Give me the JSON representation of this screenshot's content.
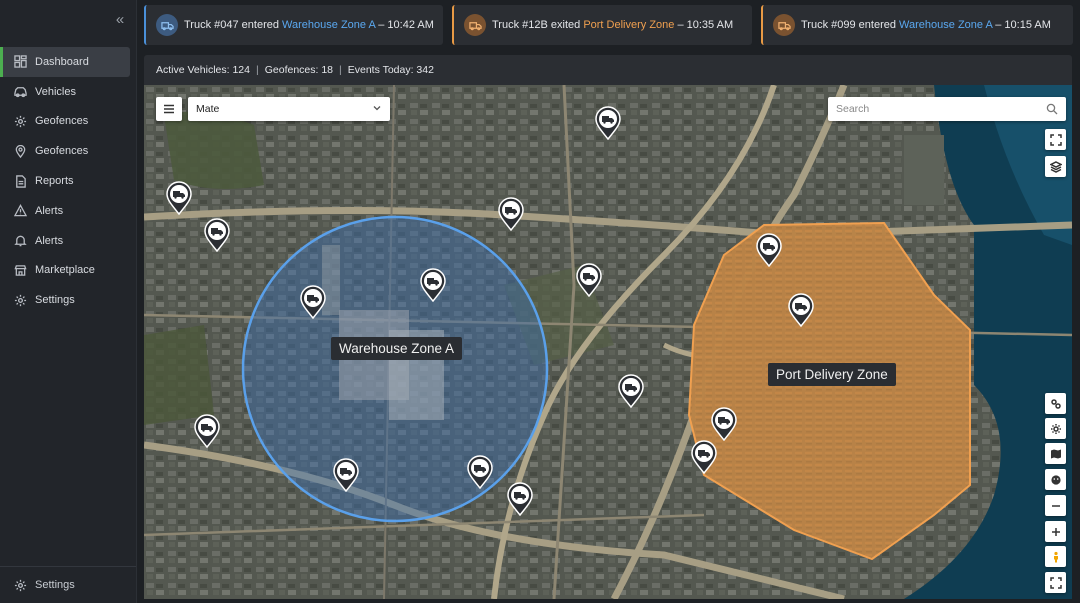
{
  "sidebar": {
    "items": [
      {
        "label": "Dashboard",
        "icon": "dashboard-icon",
        "active": true
      },
      {
        "label": "Vehicles",
        "icon": "car-icon"
      },
      {
        "label": "Geofences",
        "icon": "geofence-icon"
      },
      {
        "label": "Geofences",
        "icon": "location-pin-icon"
      },
      {
        "label": "Reports",
        "icon": "report-icon"
      },
      {
        "label": "Alerts",
        "icon": "warning-icon"
      },
      {
        "label": "Alerts",
        "icon": "bell-icon"
      },
      {
        "label": "Marketplace",
        "icon": "store-icon"
      },
      {
        "label": "Settings",
        "icon": "gear-icon"
      }
    ],
    "footer_label": "Settings"
  },
  "notifications": [
    {
      "prefix": "Truck #047 entered ",
      "zone": "Warehouse Zone A",
      "suffix": " – 10:42 AM",
      "color": "#4a90d9"
    },
    {
      "prefix": "Truck #12B exited ",
      "zone": "Port Delivery Zone",
      "suffix": " – 10:35 AM",
      "color": "#e89a45"
    },
    {
      "prefix": "Truck #099 entered ",
      "zone": "Warehouse Zone A",
      "suffix": " – 10:15 AM",
      "color": "#4a90d9"
    }
  ],
  "stats": {
    "active_vehicles": "Active Vehicles: 124",
    "geofences": "Geofences: 18",
    "events_today": "Events Today: 342",
    "separator": "|"
  },
  "map": {
    "layer_value": "Mate",
    "search_placeholder": "Search",
    "zones": {
      "warehouse": {
        "label": "Warehouse Zone A",
        "color": "#4a90d9"
      },
      "port": {
        "label": "Port Delivery Zone",
        "color": "#e89a45"
      }
    }
  },
  "colors": {
    "accent_active": "#4caf50",
    "warehouse_zone": "#4a90d9",
    "port_zone": "#e89a45"
  }
}
